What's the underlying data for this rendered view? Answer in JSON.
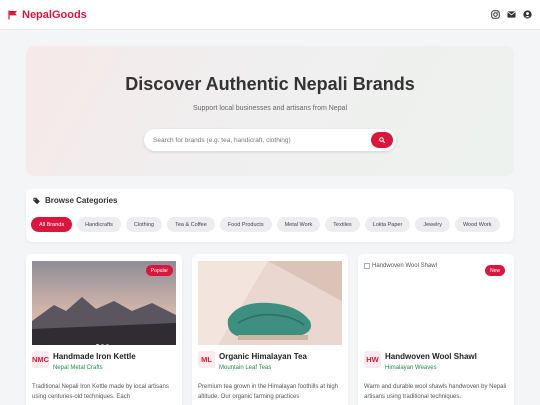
{
  "navbar": {
    "brand": "NepalGoods",
    "icons": [
      "instagram-icon",
      "mail-icon",
      "user-icon"
    ],
    "accent": "#d9163d"
  },
  "hero": {
    "title": "Discover Authentic Nepali Brands",
    "subtitle": "Support local businesses and artisans from Nepal",
    "search_placeholder": "Search for brands (e.g. tea, handicraft, clothing)",
    "search_value": ""
  },
  "categories": {
    "heading": "Browse Categories",
    "items": [
      "All Brands",
      "Handicrafts",
      "Clothing",
      "Tea & Coffee",
      "Food Products",
      "Metal Work",
      "Textiles",
      "Lokta Paper",
      "Jewelry",
      "Wood Work"
    ],
    "active": "All Brands"
  },
  "cards": [
    {
      "badge": "Popular",
      "logo": "NMC",
      "title": "Handmade Iron Kettle",
      "brand": "Nepal Metal Crafts",
      "description": "Traditional Nepali Iron Kettle made by local artisans using centuries-old techniques. Each"
    },
    {
      "badge": "",
      "logo": "ML",
      "title": "Organic Himalayan Tea",
      "brand": "Mountain Leaf Teas",
      "description": "Premium tea grown in the Himalayan foothills at high altitude. Our organic farming practices"
    },
    {
      "badge": "New",
      "logo": "HW",
      "title": "Handwoven Wool Shawl",
      "brand": "Himalayan Weaves",
      "image_alt": "Handwoven Wool Shawl",
      "description": "Warm and durable wool shawls handwoven by Nepali artisans using traditional techniques."
    }
  ]
}
